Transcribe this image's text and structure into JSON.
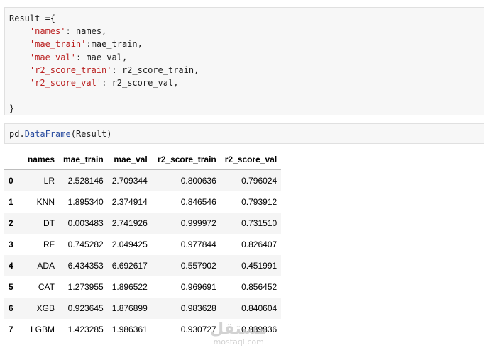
{
  "cell1": {
    "lines": [
      {
        "t1": "Result ={"
      },
      {
        "indent": "    ",
        "key": "'names'",
        "sep": ": ",
        "val": "names,"
      },
      {
        "indent": "    ",
        "key": "'mae_train'",
        "sep": ":",
        "val": "mae_train,"
      },
      {
        "indent": "    ",
        "key": "'mae_val'",
        "sep": ": ",
        "val": "mae_val,"
      },
      {
        "indent": "    ",
        "key": "'r2_score_train'",
        "sep": ": ",
        "val": "r2_score_train,"
      },
      {
        "indent": "    ",
        "key": "'r2_score_val'",
        "sep": ": ",
        "val": "r2_score_val,"
      },
      {
        "t1": ""
      },
      {
        "t1": "}"
      }
    ]
  },
  "cell2": {
    "obj": "pd",
    "dot": ".",
    "func": "DataFrame",
    "args": "(Result)"
  },
  "table": {
    "columns": [
      "",
      "names",
      "mae_train",
      "mae_val",
      "r2_score_train",
      "r2_score_val"
    ],
    "rows": [
      {
        "index": "0",
        "names": "LR",
        "mae_train": "2.528146",
        "mae_val": "2.709344",
        "r2_score_train": "0.800636",
        "r2_score_val": "0.796024"
      },
      {
        "index": "1",
        "names": "KNN",
        "mae_train": "1.895340",
        "mae_val": "2.374914",
        "r2_score_train": "0.846546",
        "r2_score_val": "0.793912"
      },
      {
        "index": "2",
        "names": "DT",
        "mae_train": "0.003483",
        "mae_val": "2.741926",
        "r2_score_train": "0.999972",
        "r2_score_val": "0.731510"
      },
      {
        "index": "3",
        "names": "RF",
        "mae_train": "0.745282",
        "mae_val": "2.049425",
        "r2_score_train": "0.977844",
        "r2_score_val": "0.826407"
      },
      {
        "index": "4",
        "names": "ADA",
        "mae_train": "6.434353",
        "mae_val": "6.692617",
        "r2_score_train": "0.557902",
        "r2_score_val": "0.451991"
      },
      {
        "index": "5",
        "names": "CAT",
        "mae_train": "1.273955",
        "mae_val": "1.896522",
        "r2_score_train": "0.969691",
        "r2_score_val": "0.856452"
      },
      {
        "index": "6",
        "names": "XGB",
        "mae_train": "0.923645",
        "mae_val": "1.876899",
        "r2_score_train": "0.983628",
        "r2_score_val": "0.840604"
      },
      {
        "index": "7",
        "names": "LGBM",
        "mae_train": "1.423285",
        "mae_val": "1.986361",
        "r2_score_train": "0.930727",
        "r2_score_val": "0.839836"
      }
    ]
  },
  "watermark": {
    "logo": "مستقل",
    "text": "mostaql.com"
  },
  "colors": {
    "string": "#ba2121",
    "function": "#2d4fa1",
    "cell_bg": "#f7f7f7",
    "row_stripe": "#f5f5f5"
  }
}
